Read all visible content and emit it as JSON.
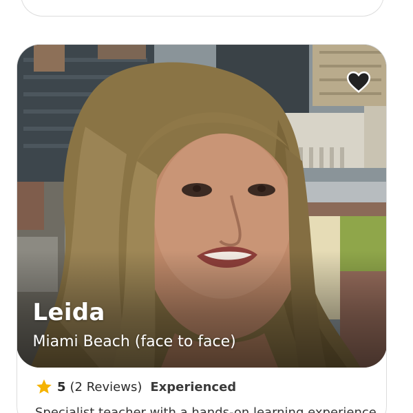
{
  "tutor": {
    "name": "Leida",
    "location": "Miami Beach (face to face)",
    "rating_value": "5",
    "reviews_text": "(2 Reviews)",
    "level": "Experienced",
    "bio": "Specialist teacher with a hands-on learning experience"
  },
  "icons": {
    "favorite": "heart-icon",
    "rating": "star-icon"
  },
  "colors": {
    "star": "#f5b301",
    "heart": "#222222",
    "card_border": "#dcdcdc"
  }
}
